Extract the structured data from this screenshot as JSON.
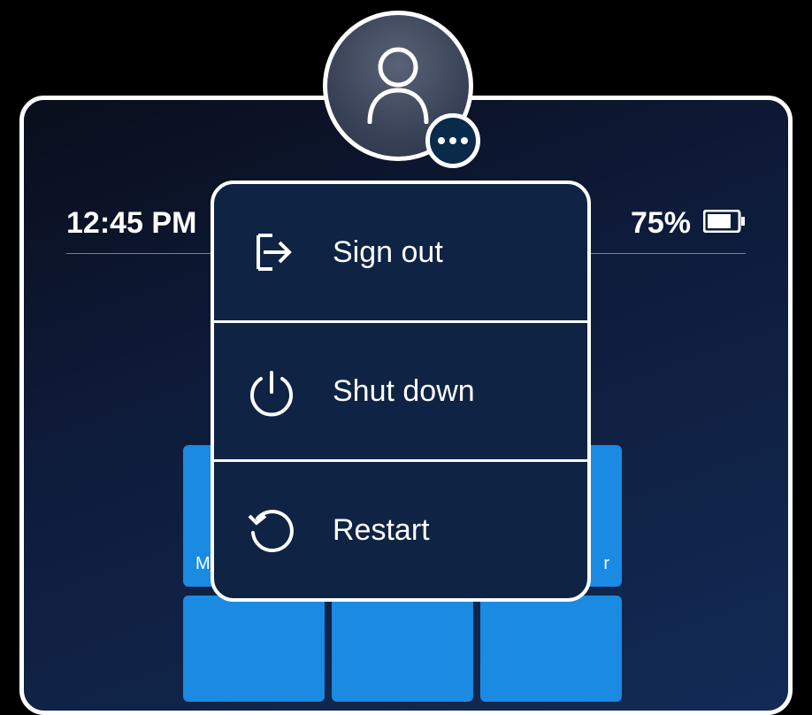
{
  "status": {
    "time": "12:45 PM",
    "battery_pct": "75%"
  },
  "menu": {
    "sign_out": "Sign out",
    "shut_down": "Shut down",
    "restart": "Restart"
  },
  "tiles": {
    "t1": "Mic",
    "t2": "r"
  }
}
